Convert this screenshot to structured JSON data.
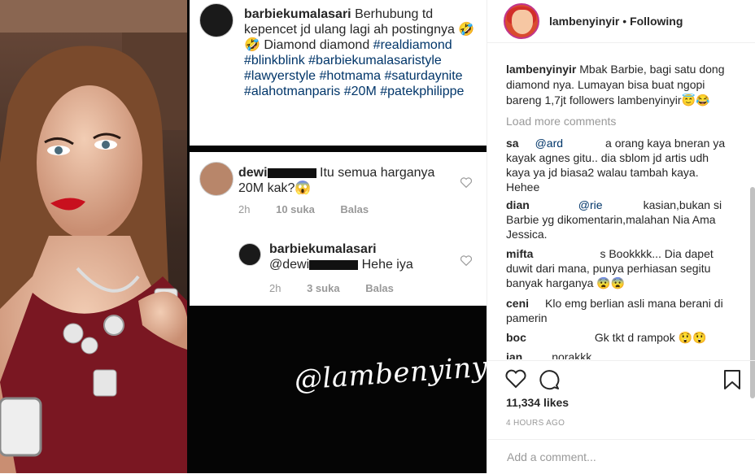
{
  "header": {
    "username": "lambenyinyir",
    "separator": "•",
    "follow_state": "Following"
  },
  "post": {
    "watermark": "@lambenyinyir",
    "screenshot_caption": {
      "username": "barbiekumalasari",
      "text": "Berhubung td kepencet jd ulang lagi ah postingnya 🤣🤣 Diamond diamond",
      "hashtags": "#realdiamond #blinkblink #barbiekumalasaristyle #lawyerstyle #hotmama #saturdaynite #alahotmanparis #20M #patekphilippe"
    },
    "screenshot_comment": {
      "username": "dewi",
      "text": "Itu semua harganya 20M kak?😱",
      "time": "2h",
      "likes": "10 suka",
      "reply": "Balas"
    },
    "screenshot_reply": {
      "username": "barbiekumalasari",
      "mention": "@dewi",
      "text": "Hehe iya",
      "time": "2h",
      "likes": "3 suka",
      "reply": "Balas"
    }
  },
  "caption": {
    "username": "lambenyinyir",
    "text": "Mbak Barbie, bagi satu dong diamond nya. Lumayan bisa buat ngopi bareng 1,7jt followers lambenyinyir😇😂"
  },
  "load_more": "Load more comments",
  "comments": [
    {
      "user": "sa",
      "mention": "@ard",
      "text": "a orang kaya bneran ya kayak agnes gitu.. dia sblom jd artis udh kaya ya jd biasa2 walau tambah kaya. Hehee"
    },
    {
      "user": "dian",
      "mention": "@rie",
      "text": "kasian,bukan si Barbie yg dikomentarin,malahan Nia Ama Jessica."
    },
    {
      "user": "mifta",
      "mention": "",
      "text": "s Bookkkk... Dia dapet duwit dari mana, punya perhiasan segitu banyak harganya 😨😨"
    },
    {
      "user": "ceni",
      "mention": "",
      "text": "Klo emg berlian asli mana berani di pamerin"
    },
    {
      "user": "boc",
      "mention": "",
      "text": "Gk tkt d rampok 😲😲"
    },
    {
      "user": "ian",
      "mention": "",
      "text": "norakkk"
    }
  ],
  "likes": "11,334 likes",
  "time_ago": "4 HOURS AGO",
  "add_comment_placeholder": "Add a comment...",
  "icons": {
    "like": "heart-icon",
    "comment": "comment-icon",
    "save": "bookmark-icon"
  },
  "colors": {
    "text": "#262626",
    "muted": "#999999",
    "link": "#003569",
    "border": "#efefef"
  }
}
